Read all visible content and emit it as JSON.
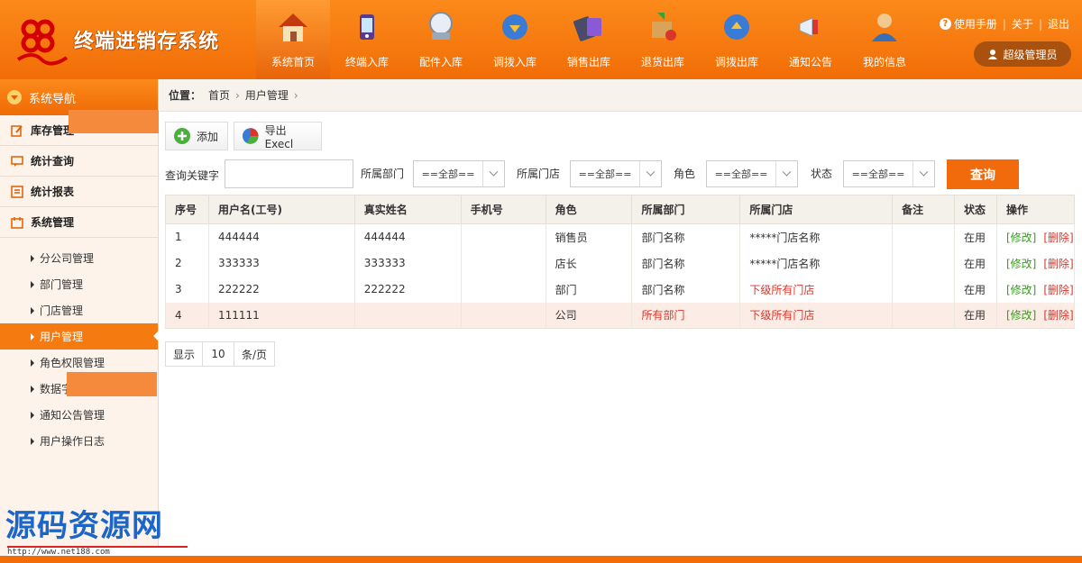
{
  "app": {
    "title": "终端进销存系统"
  },
  "nav": [
    {
      "label": "系统首页",
      "icon": "home-icon",
      "active": true
    },
    {
      "label": "终端入库",
      "icon": "phone-import-icon"
    },
    {
      "label": "配件入库",
      "icon": "accessory-import-icon"
    },
    {
      "label": "调拨入库",
      "icon": "transfer-in-icon"
    },
    {
      "label": "销售出库",
      "icon": "sales-out-icon"
    },
    {
      "label": "退货出库",
      "icon": "return-out-icon"
    },
    {
      "label": "调拨出库",
      "icon": "transfer-out-icon"
    },
    {
      "label": "通知公告",
      "icon": "megaphone-icon"
    },
    {
      "label": "我的信息",
      "icon": "user-profile-icon"
    }
  ],
  "top_links": {
    "manual": "使用手册",
    "about": "关于",
    "logout": "退出"
  },
  "user": {
    "role": "超级管理员"
  },
  "sidebar": {
    "title": "系统导航",
    "groups": [
      {
        "label": "库存管理"
      },
      {
        "label": "统计查询"
      },
      {
        "label": "统计报表"
      },
      {
        "label": "系统管理"
      }
    ],
    "sub_items": [
      {
        "label": "分公司管理"
      },
      {
        "label": "部门管理"
      },
      {
        "label": "门店管理"
      },
      {
        "label": "用户管理",
        "active": true
      },
      {
        "label": "角色权限管理"
      },
      {
        "label": "数据字典"
      },
      {
        "label": "通知公告管理"
      },
      {
        "label": "用户操作日志"
      }
    ]
  },
  "breadcrumb": {
    "prefix": "位置：",
    "home": "首页",
    "current": "用户管理"
  },
  "toolbar": {
    "add": "添加",
    "export": "导出Execl"
  },
  "filters": {
    "keyword_label": "查询关键字",
    "dept_label": "所属部门",
    "dept_value": "==全部==",
    "store_label": "所属门店",
    "store_value": "==全部==",
    "role_label": "角色",
    "role_value": "==全部==",
    "status_label": "状态",
    "status_value": "==全部==",
    "query": "查询"
  },
  "table": {
    "headers": [
      "序号",
      "用户名(工号)",
      "真实姓名",
      "手机号",
      "角色",
      "所属部门",
      "所属门店",
      "备注",
      "状态",
      "操作"
    ],
    "rows": [
      {
        "no": "1",
        "username": "444444",
        "realname": "444444",
        "phone": "",
        "role": "销售员",
        "dept": "部门名称",
        "store": "*****门店名称",
        "note": "",
        "status": "在用"
      },
      {
        "no": "2",
        "username": "333333",
        "realname": "333333",
        "phone": "",
        "role": "店长",
        "dept": "部门名称",
        "store": "*****门店名称",
        "note": "",
        "status": "在用"
      },
      {
        "no": "3",
        "username": "222222",
        "realname": "222222",
        "phone": "",
        "role": "部门",
        "dept": "部门名称",
        "store": "下级所有门店",
        "note": "",
        "status": "在用"
      },
      {
        "no": "4",
        "username": "111111",
        "realname": "",
        "phone": "",
        "role": "公司",
        "dept": "所有部门",
        "store": "下级所有门店",
        "note": "",
        "status": "在用"
      }
    ],
    "edit_label": "[修改]",
    "delete_label": "[删除]"
  },
  "pager": {
    "show": "显示",
    "size": "10",
    "unit": "条/页"
  },
  "watermark": {
    "text": "源码资源网",
    "url": "http://www.net188.com"
  },
  "colors": {
    "primary": "#f26d07",
    "danger": "#d9362b",
    "success": "#3a9a23"
  }
}
